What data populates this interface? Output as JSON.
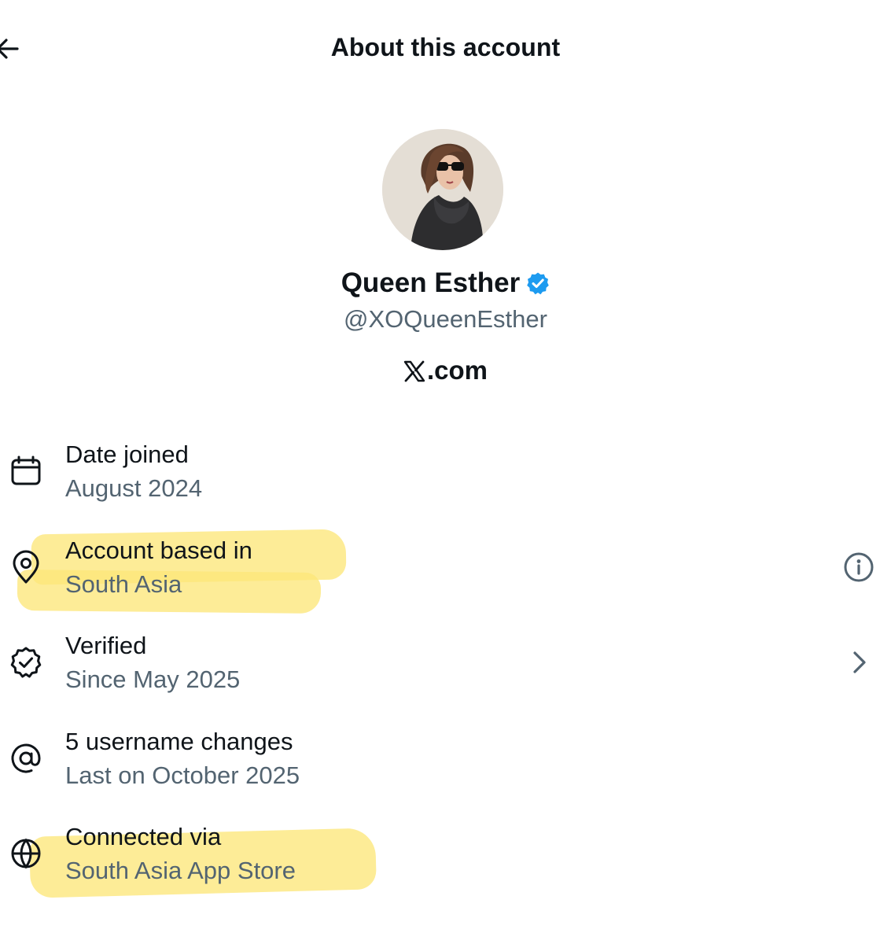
{
  "header": {
    "title": "About this account",
    "back_icon": "arrow-left-icon"
  },
  "profile": {
    "name": "Queen Esther",
    "handle": "@XOQueenEsther",
    "site": ".com",
    "verified_color": "#1d9bf0"
  },
  "rows": [
    {
      "label": "Date joined",
      "value": "August 2024",
      "icon": "calendar-icon"
    },
    {
      "label": "Account based in",
      "value": "South Asia",
      "icon": "location-pin-icon",
      "action_icon": "info-icon"
    },
    {
      "label": "Verified",
      "value": "Since May 2025",
      "icon": "verified-check-icon",
      "action_icon": "chevron-right-icon"
    },
    {
      "label": "5 username changes",
      "value": "Last on October 2025",
      "icon": "at-sign-icon"
    },
    {
      "label": "Connected via",
      "value": "South Asia App Store",
      "icon": "globe-icon"
    }
  ],
  "colors": {
    "text_primary": "#0f1419",
    "text_secondary": "#536471",
    "highlight": "#fde77a"
  }
}
